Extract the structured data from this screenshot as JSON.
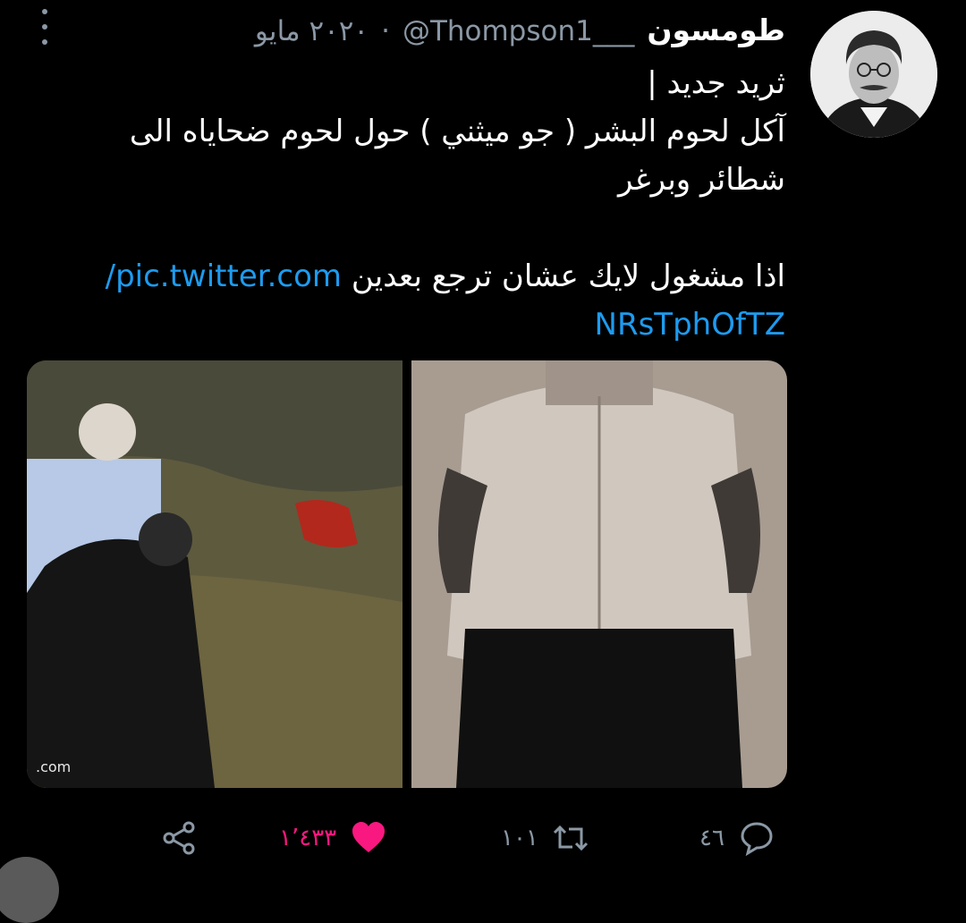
{
  "tweet": {
    "author": {
      "display_name": "طومسون",
      "handle": "@Thompson1___",
      "date": "٢٠٢٠ مايو",
      "separator": "·"
    },
    "text_lines": [
      "ثريد جديد |",
      "آكل لحوم البشر ( جو ميثني ) حول لحوم ضحاياه الى",
      "شطائر وبرغر"
    ],
    "text_line_second_part": "اذا مشغول لايك عشان ترجع بعدين",
    "link_part1": "pic.twitter.com/",
    "link_part2": "NRsTphOfTZ",
    "media": [
      {
        "name": "scene-photo",
        "overlay_text": ".com"
      },
      {
        "name": "portrait-photo"
      }
    ],
    "actions": {
      "replies": "٤٦",
      "retweets": "١٠١",
      "likes": "١٬٤٣٣",
      "share_icon": "share-icon",
      "reply_icon": "reply-icon",
      "retweet_icon": "retweet-icon",
      "like_icon": "heart-filled-icon"
    },
    "colors": {
      "link": "#1d9bf0",
      "like": "#f91880",
      "muted": "#8b98a5",
      "background": "#000000"
    }
  }
}
